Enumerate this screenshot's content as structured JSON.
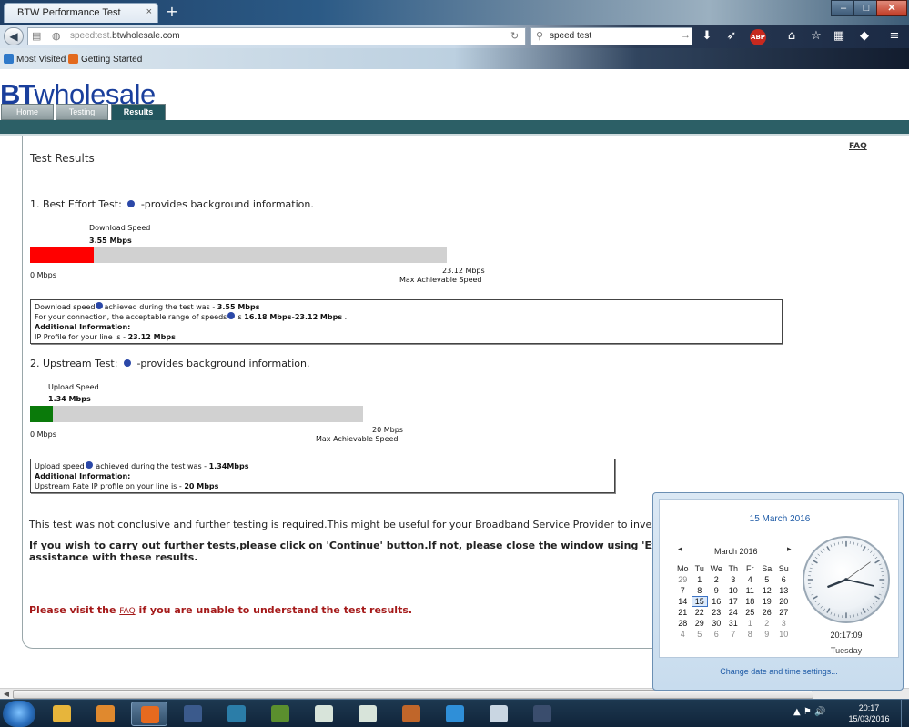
{
  "browser": {
    "tab_title": "BTW Performance Test",
    "tab_close": "×",
    "new_tab": "+",
    "url_host_prefix": "speedtest.",
    "url_domain": "btwholesale.com",
    "search_value": "speed test",
    "bookmarks": [
      {
        "label": "Most Visited",
        "color": "#2f79c9"
      },
      {
        "label": "Getting Started",
        "color": "#e36a1e"
      }
    ],
    "window_controls": {
      "min": "–",
      "max": "□",
      "close": "✕"
    },
    "abp_label": "ABP"
  },
  "site": {
    "logo_bold": "BT",
    "logo_text": "wholesale",
    "nav_tabs": [
      "Home",
      "Testing",
      "Results"
    ],
    "active_tab": "Results",
    "faq_top": "FAQ",
    "heading": "Test Results"
  },
  "download": {
    "section_title": "1. Best Effort Test:",
    "section_suffix": "-provides background information.",
    "speed_label": "Download Speed",
    "speed_value": "3.55 Mbps",
    "min_label": "0 Mbps",
    "max_value": "23.12 Mbps",
    "max_label": "Max Achievable Speed",
    "fraction": 0.1535,
    "fill_color": "#ff0000",
    "info": {
      "line1_a": "Download speed",
      "line1_b": "achieved during the test was - ",
      "line1_value": "3.55 Mbps",
      "line2_a": "For your connection, the acceptable range of speeds",
      "line2_b": "is ",
      "line2_value": "16.18 Mbps-23.12 Mbps",
      "line2_end": " .",
      "line3": "Additional Information:",
      "line4_a": "IP Profile for your line is - ",
      "line4_value": "23.12 Mbps"
    }
  },
  "upload": {
    "section_title": "2. Upstream Test:",
    "section_suffix": "-provides background information.",
    "speed_label": "Upload Speed",
    "speed_value": "1.34 Mbps",
    "min_label": "0 Mbps",
    "max_value": "20 Mbps",
    "max_label": "Max Achievable Speed",
    "fraction": 0.067,
    "fill_color": "#0a7a0a",
    "info": {
      "line1_a": "Upload speed",
      "line1_b": " achieved during the test was - ",
      "line1_value": "1.34Mbps",
      "line2": "Additional Information:",
      "line3_a": "Upstream Rate IP profile on your line is - ",
      "line3_value": "20 Mbps"
    }
  },
  "messages": {
    "inconclusive": "This test was not conclusive and further testing is required.This might be useful for your Broadband Service Provider to investigate t",
    "continue_line1": "If you wish to carry out further tests,please click on 'Continue' button.If not, please close the window using 'Exit' button a",
    "continue_line2": "assistance with these results.",
    "faq_prefix": "Please visit the ",
    "faq_link": "FAQ",
    "faq_suffix": " if you are unable to understand the test results."
  },
  "calendar": {
    "full_date": "15 March 2016",
    "month_label": "March 2016",
    "prev": "◂",
    "next": "▸",
    "weekdays": [
      "Mo",
      "Tu",
      "We",
      "Th",
      "Fr",
      "Sa",
      "Su"
    ],
    "weeks": [
      [
        "29",
        "1",
        "2",
        "3",
        "4",
        "5",
        "6"
      ],
      [
        "7",
        "8",
        "9",
        "10",
        "11",
        "12",
        "13"
      ],
      [
        "14",
        "15",
        "16",
        "17",
        "18",
        "19",
        "20"
      ],
      [
        "21",
        "22",
        "23",
        "24",
        "25",
        "26",
        "27"
      ],
      [
        "28",
        "29",
        "30",
        "31",
        "1",
        "2",
        "3"
      ],
      [
        "4",
        "5",
        "6",
        "7",
        "8",
        "9",
        "10"
      ]
    ],
    "today": "15",
    "clock_time": "20:17:09",
    "clock_day": "Tuesday",
    "clock_hour": 20,
    "clock_minute": 17,
    "clock_second": 9,
    "settings_link": "Change date and time settings..."
  },
  "taskbar": {
    "time": "20:17",
    "date": "15/03/2016",
    "tray_icons": "▲ ⚑ 🔊",
    "apps": [
      {
        "name": "explorer",
        "color": "#e7b53b"
      },
      {
        "name": "media-player",
        "color": "#e0892e"
      },
      {
        "name": "firefox",
        "color": "#e66a1f",
        "active": true
      },
      {
        "name": "game-star",
        "color": "#3b5a8c"
      },
      {
        "name": "game-2",
        "color": "#2b7da8"
      },
      {
        "name": "minecraft",
        "color": "#5b8f2e"
      },
      {
        "name": "window-1",
        "color": "#d8e4da"
      },
      {
        "name": "window-2",
        "color": "#d8e4da"
      },
      {
        "name": "game-3",
        "color": "#c0662a"
      },
      {
        "name": "internet-explorer",
        "color": "#2f8fd8"
      },
      {
        "name": "app-power",
        "color": "#c9d6e2"
      },
      {
        "name": "game-4",
        "color": "#3a4d6d"
      }
    ]
  }
}
